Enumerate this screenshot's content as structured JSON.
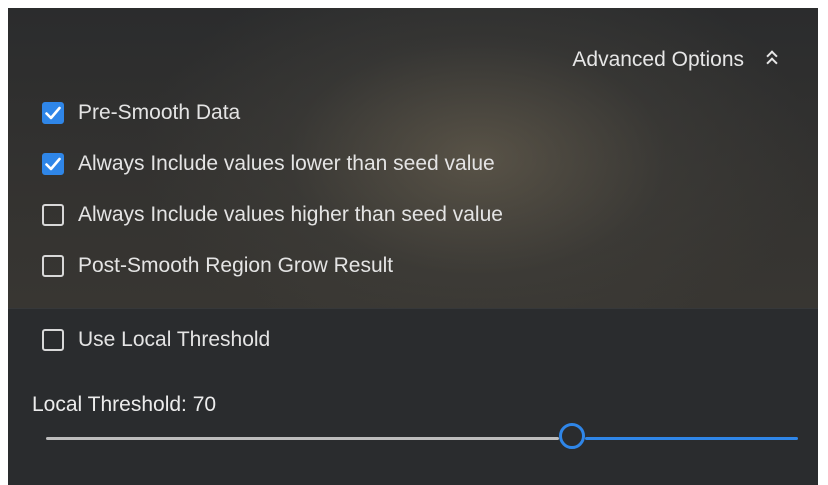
{
  "advanced_options": {
    "label": "Advanced Options",
    "icon": "double-chevron-up-icon",
    "options": [
      {
        "label": "Pre-Smooth Data",
        "checked": true
      },
      {
        "label": "Always Include values lower than seed value",
        "checked": true
      },
      {
        "label": "Always Include values higher than seed value",
        "checked": false
      },
      {
        "label": "Post-Smooth Region Grow Result",
        "checked": false
      }
    ]
  },
  "local_threshold": {
    "use_label": "Use Local Threshold",
    "use_checked": false,
    "slider_label": "Local Threshold:",
    "value": "70",
    "slider_fraction": 0.7
  },
  "colors": {
    "accent": "#2f86e8",
    "panel_bg": "#2a2c2e",
    "text": "#e4e4e4"
  }
}
